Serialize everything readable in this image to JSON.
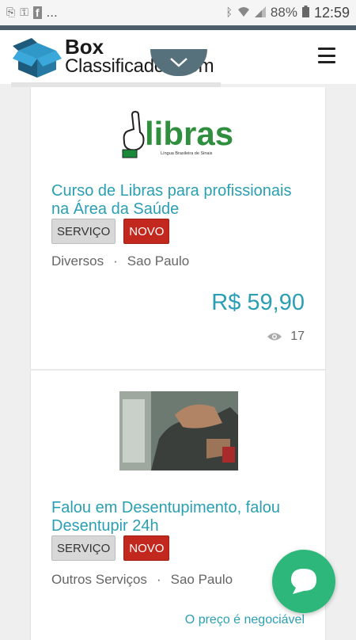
{
  "status_bar": {
    "overflow": "...",
    "battery": "88%",
    "time": "12:59"
  },
  "header": {
    "logo_line1": "Box",
    "logo_line2": "Classificados.com"
  },
  "listings": [
    {
      "title": "Curso de Libras para profissionais na Área da Saúde",
      "badges": [
        "SERVIÇO",
        "NOVO"
      ],
      "category": "Diversos",
      "separator": "·",
      "location": "Sao Paulo",
      "price": "R$ 59,90",
      "views": "17",
      "image_text": "libras",
      "image_subtext": "Língua Brasileira de Sinais"
    },
    {
      "title": "Falou em Desentupimento, falou Desentupir 24h",
      "badges": [
        "SERVIÇO",
        "NOVO"
      ],
      "category": "Outros Serviços",
      "separator": "·",
      "location": "Sao Paulo",
      "price_note": "O preço é negociável"
    }
  ],
  "colors": {
    "accent": "#2a9fb3",
    "novo_badge": "#c3281e",
    "chat_button": "#2db77a",
    "header_strip": "#4c5f6b"
  }
}
